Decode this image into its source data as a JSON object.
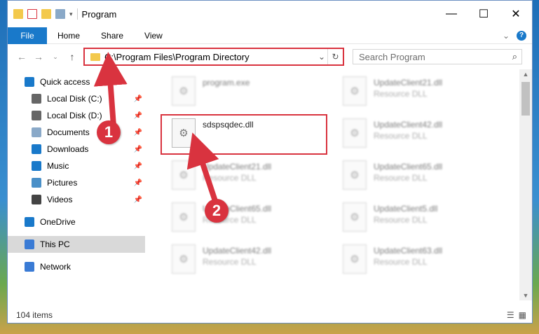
{
  "titlebar": {
    "title": "Program",
    "minimize": "—",
    "maximize": "☐",
    "close": "✕"
  },
  "ribbon": {
    "file": "File",
    "tabs": [
      "Home",
      "Share",
      "View"
    ],
    "help": "?"
  },
  "navigation": {
    "address": "C:\\Program Files\\Program Directory",
    "search_placeholder": "Search Program"
  },
  "sidebar": {
    "items": [
      {
        "label": "Quick access",
        "icon": "star-icon",
        "color": "#1979ca"
      },
      {
        "label": "Local Disk (C:)",
        "icon": "drive-icon",
        "color": "#666666",
        "pinned": true
      },
      {
        "label": "Local Disk (D:)",
        "icon": "drive-icon",
        "color": "#666666",
        "pinned": true
      },
      {
        "label": "Documents",
        "icon": "documents-icon",
        "color": "#8aa9c8",
        "pinned": true
      },
      {
        "label": "Downloads",
        "icon": "downloads-icon",
        "color": "#1979ca",
        "pinned": true
      },
      {
        "label": "Music",
        "icon": "music-icon",
        "color": "#1979ca",
        "pinned": true
      },
      {
        "label": "Pictures",
        "icon": "pictures-icon",
        "color": "#4a90c8",
        "pinned": true
      },
      {
        "label": "Videos",
        "icon": "videos-icon",
        "color": "#444444",
        "pinned": true
      },
      {
        "label": "OneDrive",
        "icon": "cloud-icon",
        "color": "#1979ca"
      },
      {
        "label": "This PC",
        "icon": "computer-icon",
        "color": "#3a7bd5",
        "selected": true
      },
      {
        "label": "Network",
        "icon": "network-icon",
        "color": "#3a7bd5"
      }
    ]
  },
  "files": [
    {
      "name": "program.exe",
      "type": "",
      "blurred": true
    },
    {
      "name": "UpdateClient21.dll",
      "type": "Resource DLL",
      "blurred": true
    },
    {
      "name": "sdspsqdec.dll",
      "type": "",
      "blurred": false
    },
    {
      "name": "UpdateClient42.dll",
      "type": "Resource DLL",
      "blurred": true
    },
    {
      "name": "UpdateClient21.dll",
      "type": "Resource DLL",
      "blurred": true
    },
    {
      "name": "UpdateClient65.dll",
      "type": "Resource DLL",
      "blurred": true
    },
    {
      "name": "UpdateClient65.dll",
      "type": "Resource DLL",
      "blurred": true
    },
    {
      "name": "UpdateClient5.dll",
      "type": "Resource DLL",
      "blurred": true
    },
    {
      "name": "UpdateClient42.dll",
      "type": "Resource DLL",
      "blurred": true
    },
    {
      "name": "UpdateClient63.dll",
      "type": "Resource DLL",
      "blurred": true
    }
  ],
  "status": {
    "count": "104 items"
  },
  "callouts": [
    "1",
    "2"
  ],
  "colors": {
    "accent": "#1979ca",
    "highlight": "#d9333f"
  }
}
